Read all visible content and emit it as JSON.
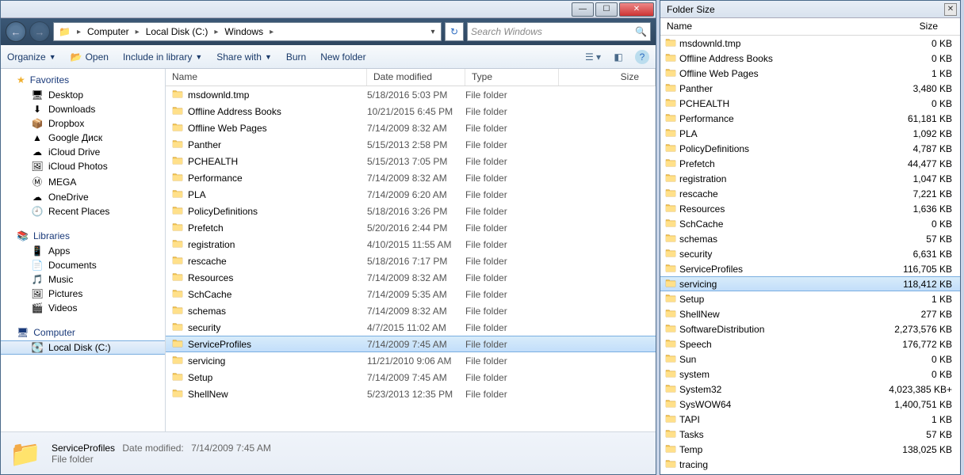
{
  "titlebar": {
    "min": "—",
    "max": "☐",
    "close": "✕"
  },
  "address": {
    "segs": [
      "Computer",
      "Local Disk (C:)",
      "Windows"
    ]
  },
  "search": {
    "placeholder": "Search Windows"
  },
  "toolbar": {
    "organize": "Organize",
    "open": "Open",
    "include": "Include in library",
    "share": "Share with",
    "burn": "Burn",
    "newfolder": "New folder"
  },
  "nav": {
    "favorites": {
      "label": "Favorites",
      "items": [
        {
          "icon": "🖥",
          "label": "Desktop"
        },
        {
          "icon": "⬇",
          "label": "Downloads"
        },
        {
          "icon": "📦",
          "label": "Dropbox"
        },
        {
          "icon": "▲",
          "label": "Google Диск"
        },
        {
          "icon": "☁",
          "label": "iCloud Drive"
        },
        {
          "icon": "🖼",
          "label": "iCloud Photos"
        },
        {
          "icon": "Ⓜ",
          "label": "MEGA"
        },
        {
          "icon": "☁",
          "label": "OneDrive"
        },
        {
          "icon": "🕘",
          "label": "Recent Places"
        }
      ]
    },
    "libraries": {
      "label": "Libraries",
      "items": [
        {
          "icon": "📱",
          "label": "Apps"
        },
        {
          "icon": "📄",
          "label": "Documents"
        },
        {
          "icon": "🎵",
          "label": "Music"
        },
        {
          "icon": "🖼",
          "label": "Pictures"
        },
        {
          "icon": "🎬",
          "label": "Videos"
        }
      ]
    },
    "computer": {
      "label": "Computer",
      "items": [
        {
          "icon": "💽",
          "label": "Local Disk (C:)",
          "sel": true
        }
      ]
    }
  },
  "columns": {
    "name": "Name",
    "date": "Date modified",
    "type": "Type",
    "size": "Size"
  },
  "files": [
    {
      "name": "msdownld.tmp",
      "date": "5/18/2016 5:03 PM",
      "type": "File folder"
    },
    {
      "name": "Offline Address Books",
      "date": "10/21/2015 6:45 PM",
      "type": "File folder"
    },
    {
      "name": "Offline Web Pages",
      "date": "7/14/2009 8:32 AM",
      "type": "File folder"
    },
    {
      "name": "Panther",
      "date": "5/15/2013 2:58 PM",
      "type": "File folder"
    },
    {
      "name": "PCHEALTH",
      "date": "5/15/2013 7:05 PM",
      "type": "File folder"
    },
    {
      "name": "Performance",
      "date": "7/14/2009 8:32 AM",
      "type": "File folder"
    },
    {
      "name": "PLA",
      "date": "7/14/2009 6:20 AM",
      "type": "File folder"
    },
    {
      "name": "PolicyDefinitions",
      "date": "5/18/2016 3:26 PM",
      "type": "File folder"
    },
    {
      "name": "Prefetch",
      "date": "5/20/2016 2:44 PM",
      "type": "File folder"
    },
    {
      "name": "registration",
      "date": "4/10/2015 11:55 AM",
      "type": "File folder"
    },
    {
      "name": "rescache",
      "date": "5/18/2016 7:17 PM",
      "type": "File folder"
    },
    {
      "name": "Resources",
      "date": "7/14/2009 8:32 AM",
      "type": "File folder"
    },
    {
      "name": "SchCache",
      "date": "7/14/2009 5:35 AM",
      "type": "File folder"
    },
    {
      "name": "schemas",
      "date": "7/14/2009 8:32 AM",
      "type": "File folder"
    },
    {
      "name": "security",
      "date": "4/7/2015 11:02 AM",
      "type": "File folder"
    },
    {
      "name": "ServiceProfiles",
      "date": "7/14/2009 7:45 AM",
      "type": "File folder",
      "sel": true
    },
    {
      "name": "servicing",
      "date": "11/21/2010 9:06 AM",
      "type": "File folder"
    },
    {
      "name": "Setup",
      "date": "7/14/2009 7:45 AM",
      "type": "File folder"
    },
    {
      "name": "ShellNew",
      "date": "5/23/2013 12:35 PM",
      "type": "File folder"
    }
  ],
  "details": {
    "name": "ServiceProfiles",
    "label": "Date modified:",
    "value": "7/14/2009 7:45 AM",
    "type": "File folder"
  },
  "sidebar": {
    "title": "Folder Size",
    "cols": {
      "name": "Name",
      "size": "Size"
    },
    "rows": [
      {
        "name": "msdownld.tmp",
        "size": "0 KB"
      },
      {
        "name": "Offline Address Books",
        "size": "0 KB"
      },
      {
        "name": "Offline Web Pages",
        "size": "1 KB"
      },
      {
        "name": "Panther",
        "size": "3,480 KB"
      },
      {
        "name": "PCHEALTH",
        "size": "0 KB"
      },
      {
        "name": "Performance",
        "size": "61,181 KB"
      },
      {
        "name": "PLA",
        "size": "1,092 KB"
      },
      {
        "name": "PolicyDefinitions",
        "size": "4,787 KB"
      },
      {
        "name": "Prefetch",
        "size": "44,477 KB"
      },
      {
        "name": "registration",
        "size": "1,047 KB"
      },
      {
        "name": "rescache",
        "size": "7,221 KB"
      },
      {
        "name": "Resources",
        "size": "1,636 KB"
      },
      {
        "name": "SchCache",
        "size": "0 KB"
      },
      {
        "name": "schemas",
        "size": "57 KB"
      },
      {
        "name": "security",
        "size": "6,631 KB"
      },
      {
        "name": "ServiceProfiles",
        "size": "116,705 KB"
      },
      {
        "name": "servicing",
        "size": "118,412 KB",
        "sel": true
      },
      {
        "name": "Setup",
        "size": "1 KB"
      },
      {
        "name": "ShellNew",
        "size": "277 KB"
      },
      {
        "name": "SoftwareDistribution",
        "size": "2,273,576 KB"
      },
      {
        "name": "Speech",
        "size": "176,772 KB"
      },
      {
        "name": "Sun",
        "size": "0 KB"
      },
      {
        "name": "system",
        "size": "0 KB"
      },
      {
        "name": "System32",
        "size": "4,023,385 KB+"
      },
      {
        "name": "SysWOW64",
        "size": "1,400,751 KB"
      },
      {
        "name": "TAPI",
        "size": "1 KB"
      },
      {
        "name": "Tasks",
        "size": "57 KB"
      },
      {
        "name": "Temp",
        "size": "138,025 KB"
      },
      {
        "name": "tracing",
        "size": ""
      }
    ]
  }
}
